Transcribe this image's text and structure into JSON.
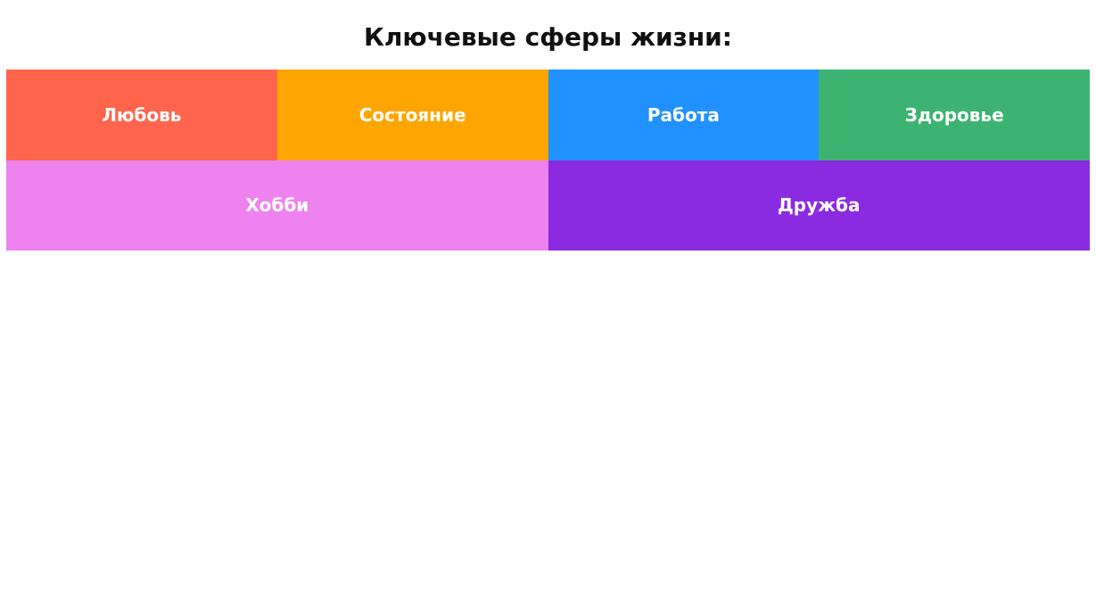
{
  "heading": "Ключевые сферы жизни:",
  "spheres": [
    {
      "label": "Любовь",
      "color": "#ff644d"
    },
    {
      "label": "Состояние",
      "color": "#ffa500"
    },
    {
      "label": "Работа",
      "color": "#2091ff"
    },
    {
      "label": "Здоровье",
      "color": "#3db371"
    },
    {
      "label": "Хобби",
      "color": "#ee82ee"
    },
    {
      "label": "Дружба",
      "color": "#8a2be2"
    }
  ]
}
